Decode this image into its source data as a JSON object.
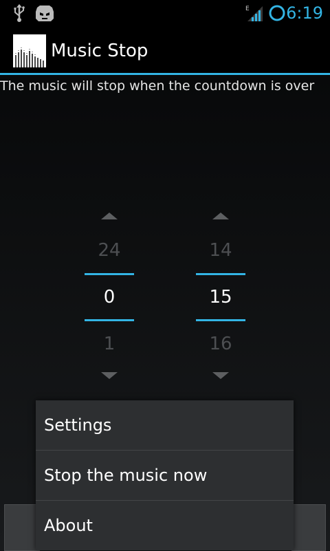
{
  "status_bar": {
    "icons": [
      "usb-icon",
      "cyanogenmod-icon",
      "signal-e-icon",
      "sync-circle-icon"
    ],
    "network_type": "E",
    "time": "6:19",
    "accent": "#33b5e5"
  },
  "action_bar": {
    "title": "Music Stop",
    "icon": "equalizer-app-icon"
  },
  "content": {
    "description": "The music will stop when the countdown is over",
    "hours_picker": {
      "prev": "24",
      "current": "0",
      "next": "1"
    },
    "minutes_picker": {
      "prev": "14",
      "current": "15",
      "next": "16"
    }
  },
  "menu": {
    "items": [
      {
        "label": "Settings"
      },
      {
        "label": "Stop the music now"
      },
      {
        "label": "About"
      }
    ]
  }
}
